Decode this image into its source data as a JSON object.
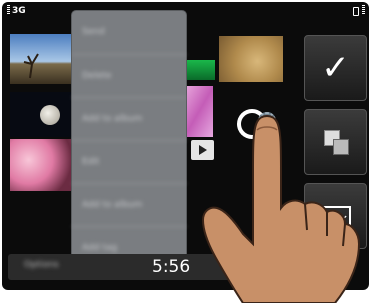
{
  "status_bar": {
    "network_type": "3G",
    "icons": [
      "signal-strength-icon",
      "battery-icon"
    ]
  },
  "gallery": {
    "thumbnails": [
      "tree-landscape",
      "moon-night",
      "cherry-blossom",
      "leopard",
      "pink-flowers",
      "green-leaf",
      "video-play",
      "loading"
    ]
  },
  "context_menu": {
    "items": [
      "Send",
      "Delete",
      "Add to album",
      "Edit",
      "Add to album",
      "Add tag"
    ]
  },
  "toolbar": {
    "buttons": [
      "checkmark-icon",
      "copy-icon",
      "envelope-icon"
    ]
  },
  "bottom_bar": {
    "softkey_label": "Options",
    "clock": "5:56"
  },
  "overlay": {
    "icons": [
      "pointing-hand-icon",
      "loading-spinner-icon",
      "settings-gear-icon",
      "play-icon"
    ]
  },
  "colors": {
    "menu_bg": "#7a7d81",
    "screen_bg": "#0b0b0b",
    "skin": "#c89068"
  }
}
